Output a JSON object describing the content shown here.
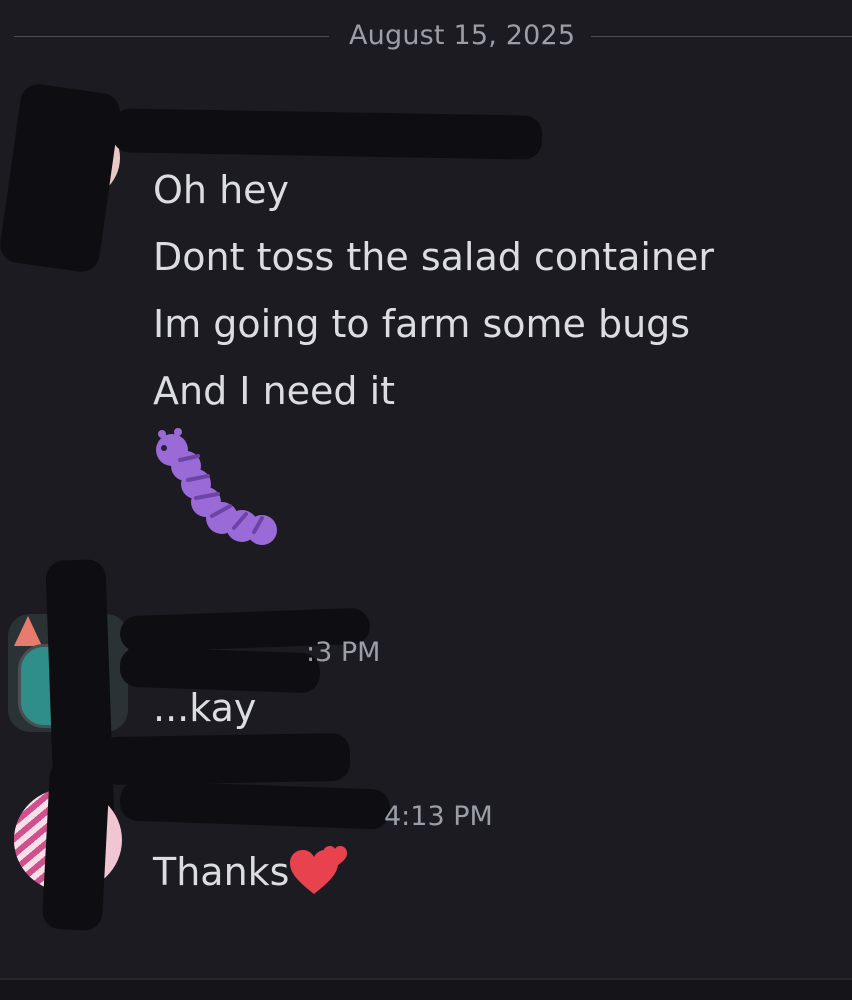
{
  "date_divider": {
    "label": "August 15, 2025"
  },
  "messages": [
    {
      "lines": [
        "Oh hey",
        "Dont toss the salad container",
        "Im going to farm some bugs",
        "And I need it"
      ],
      "sticker": "purple-caterpillar-emoji"
    },
    {
      "timestamp_partial": ":3 PM",
      "lines": [
        "...kay"
      ]
    },
    {
      "timestamp_partial": "4:13 PM",
      "lines": [
        "Thanks"
      ],
      "emoji": "two-hearts-icon"
    }
  ],
  "colors": {
    "background": "#1b1b21",
    "text": "#dcdde1",
    "muted": "#9c9ea7",
    "heart": "#e8424f",
    "caterpillar": "#9a6ad6"
  }
}
